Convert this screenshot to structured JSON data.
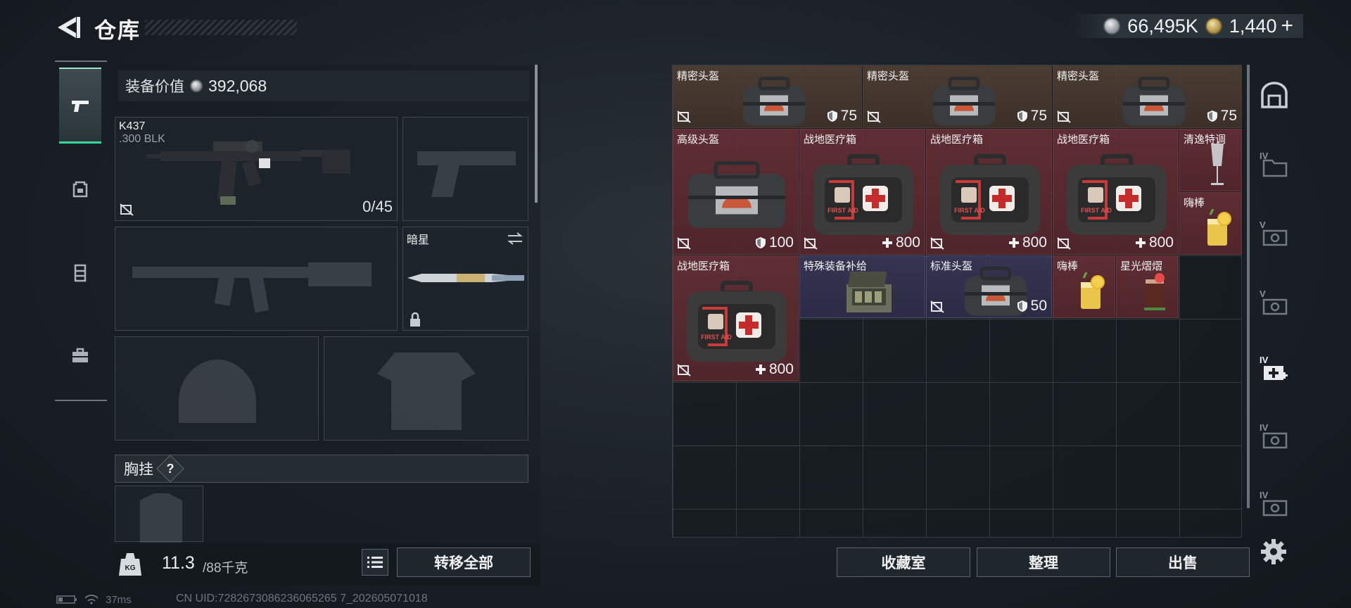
{
  "header": {
    "title": "仓库",
    "currency_silver": "66,495K",
    "currency_gold": "1,440",
    "currency_add": "+"
  },
  "equipment": {
    "value_label": "装备价值",
    "value": "392,068",
    "primary_weapon": {
      "name": "K437",
      "caliber": ".300 BLK",
      "ammo": "0/45"
    },
    "melee": {
      "name": "暗星"
    },
    "chest_rig_label": "胸挂",
    "chest_rig_help": "?"
  },
  "weight": {
    "current": "11.3",
    "max": "/88千克"
  },
  "buttons": {
    "transfer_all": "转移全部",
    "collection_room": "收藏室",
    "organize": "整理",
    "sell": "出售"
  },
  "status": {
    "ping": "37ms",
    "uid": "CN UID:7282673086236065265 7_202605071018"
  },
  "items": [
    {
      "name": "精密头盔",
      "stat": "75",
      "stat_type": "armor",
      "rarity": "brown"
    },
    {
      "name": "精密头盔",
      "stat": "75",
      "stat_type": "armor",
      "rarity": "brown"
    },
    {
      "name": "精密头盔",
      "stat": "75",
      "stat_type": "armor",
      "rarity": "brown"
    },
    {
      "name": "高级头盔",
      "stat": "100",
      "stat_type": "armor",
      "rarity": "red"
    },
    {
      "name": "战地医疗箱",
      "stat": "800",
      "stat_type": "heal",
      "rarity": "red"
    },
    {
      "name": "战地医疗箱",
      "stat": "800",
      "stat_type": "heal",
      "rarity": "red"
    },
    {
      "name": "战地医疗箱",
      "stat": "800",
      "stat_type": "heal",
      "rarity": "red"
    },
    {
      "name": "清逸特调",
      "stat": "",
      "stat_type": "none",
      "rarity": "red"
    },
    {
      "name": "嗨棒",
      "stat": "",
      "stat_type": "none",
      "rarity": "red"
    },
    {
      "name": "战地医疗箱",
      "stat": "800",
      "stat_type": "heal",
      "rarity": "red"
    },
    {
      "name": "特殊装备补给",
      "stat": "",
      "stat_type": "none",
      "rarity": "purple"
    },
    {
      "name": "标准头盔",
      "stat": "50",
      "stat_type": "armor",
      "rarity": "purple"
    },
    {
      "name": "嗨棒",
      "stat": "",
      "stat_type": "none",
      "rarity": "red"
    },
    {
      "name": "星光熠熠",
      "stat": "",
      "stat_type": "none",
      "rarity": "red"
    }
  ],
  "first_aid_text": "FIRST AID",
  "rail_labels": [
    "IV",
    "V",
    "V",
    "IV",
    "IV",
    "IV"
  ],
  "colors": {
    "accent_green": "#37d596",
    "rarity_red": "#682f36",
    "rarity_purple": "#3a3858",
    "rarity_brown": "#544236"
  }
}
